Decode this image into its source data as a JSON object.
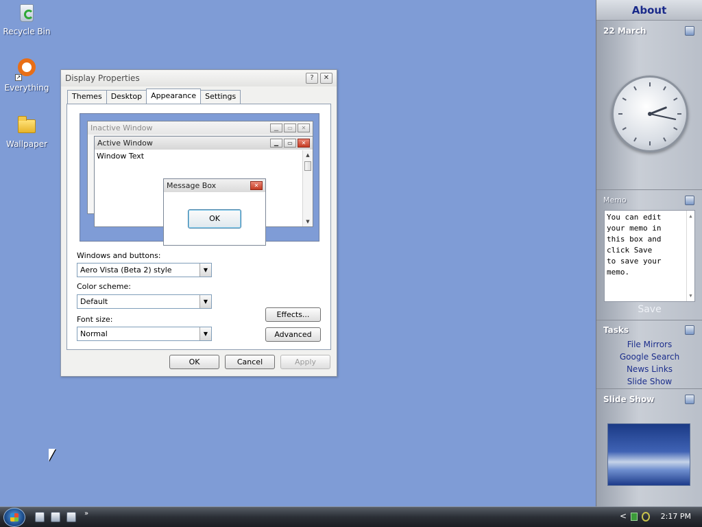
{
  "desktop": {
    "icons": [
      {
        "label": "Recycle Bin"
      },
      {
        "label": "Everything"
      },
      {
        "label": "Wallpaper"
      }
    ]
  },
  "dialog": {
    "title": "Display Properties",
    "help_glyph": "?",
    "close_glyph": "✕",
    "tabs": [
      "Themes",
      "Desktop",
      "Appearance",
      "Settings"
    ],
    "active_tab": "Appearance",
    "preview": {
      "inactive_title": "Inactive Window",
      "active_title": "Active Window",
      "window_text": "Window Text",
      "message_title": "Message Box",
      "message_ok": "OK"
    },
    "windows_buttons_label": "Windows and buttons:",
    "windows_buttons_value": "Aero Vista (Beta 2) style",
    "color_scheme_label": "Color scheme:",
    "color_scheme_value": "Default",
    "font_size_label": "Font size:",
    "font_size_value": "Normal",
    "effects_label": "Effects...",
    "advanced_label": "Advanced",
    "ok_label": "OK",
    "cancel_label": "Cancel",
    "apply_label": "Apply"
  },
  "sidebar": {
    "header": "About",
    "date": "22 March",
    "clock": {
      "hour": 2,
      "minute": 17
    },
    "memo_title": "Memo",
    "memo_text": "You can edit\nyour memo in\nthis box and\nclick Save\nto save your\nmemo.",
    "save_label": "Save",
    "tasks_title": "Tasks",
    "tasks": [
      "File Mirrors",
      "Google Search",
      "News Links",
      "Slide Show"
    ],
    "slideshow_title": "Slide Show"
  },
  "taskbar": {
    "overflow_glyph": "»",
    "tray_chevron": "<",
    "time": "2:17 PM"
  }
}
